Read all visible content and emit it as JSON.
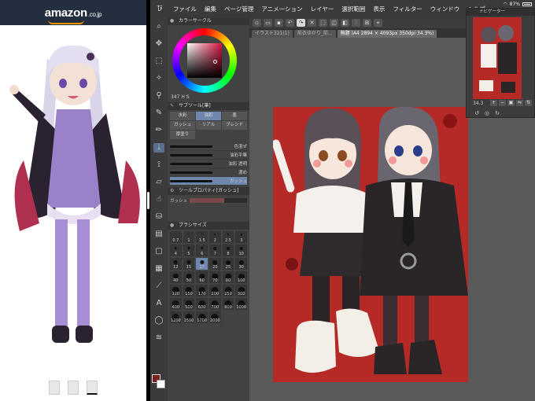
{
  "amazon": {
    "logo_text": "amazon",
    "logo_domain": ".co.jp",
    "thumbnails": [
      "thumb-1",
      "thumb-2",
      "thumb-3"
    ],
    "selected_thumbnail": 3
  },
  "status_bar": {
    "battery": "87%"
  },
  "app": {
    "menu": [
      "ファイル",
      "編集",
      "ページ管理",
      "アニメーション",
      "レイヤー",
      "選択範囲",
      "表示",
      "フィルター",
      "ウィンドウ",
      "ヘルプ"
    ],
    "document_tabs": [
      {
        "label": "イラスト321(1)"
      },
      {
        "label": "前衣ゆかり_前..."
      },
      {
        "label": "無題 (A4 2894 × 4093px 350dpi 34.3%)"
      }
    ],
    "active_tab": 2
  },
  "panels": {
    "color_circle": {
      "title": "カラーサークル",
      "values": "347  H  S"
    },
    "subtool": {
      "title": "サブツール[筆]",
      "items": [
        "水彩",
        "油彩",
        "墨",
        "ガッシュ",
        "リアル",
        "ブレンド",
        "厚塗り"
      ]
    },
    "brushes": [
      {
        "name": "色混ぜ"
      },
      {
        "name": "油彩平筆"
      },
      {
        "name": "油彩 透明"
      },
      {
        "name": "濃め"
      },
      {
        "name": "ガッシュ"
      }
    ],
    "tool_property": {
      "title": "ツールプロパティ[ガッシュ]",
      "name": "ガッシュ",
      "level": 0.6
    },
    "brush_size": {
      "title": "ブラシサイズ",
      "sizes": [
        "0.7",
        "1",
        "1.5",
        "2",
        "2.5",
        "3",
        "4",
        "5",
        "6",
        "7",
        "8",
        "10",
        "12",
        "15",
        "17",
        "20",
        "25",
        "30",
        "40",
        "50",
        "60",
        "70",
        "80",
        "100",
        "120",
        "150",
        "170",
        "200",
        "250",
        "300",
        "400",
        "500",
        "600",
        "700",
        "800",
        "1000",
        "1200",
        "1500",
        "1700",
        "2000"
      ],
      "selected_index": 14
    }
  },
  "navigator": {
    "title": "ナビゲーター",
    "zoom": "34.3"
  },
  "colors": {
    "canvas_bg": "#b52a27",
    "main_color": "#7b2020",
    "accent": "#6f86ad"
  }
}
